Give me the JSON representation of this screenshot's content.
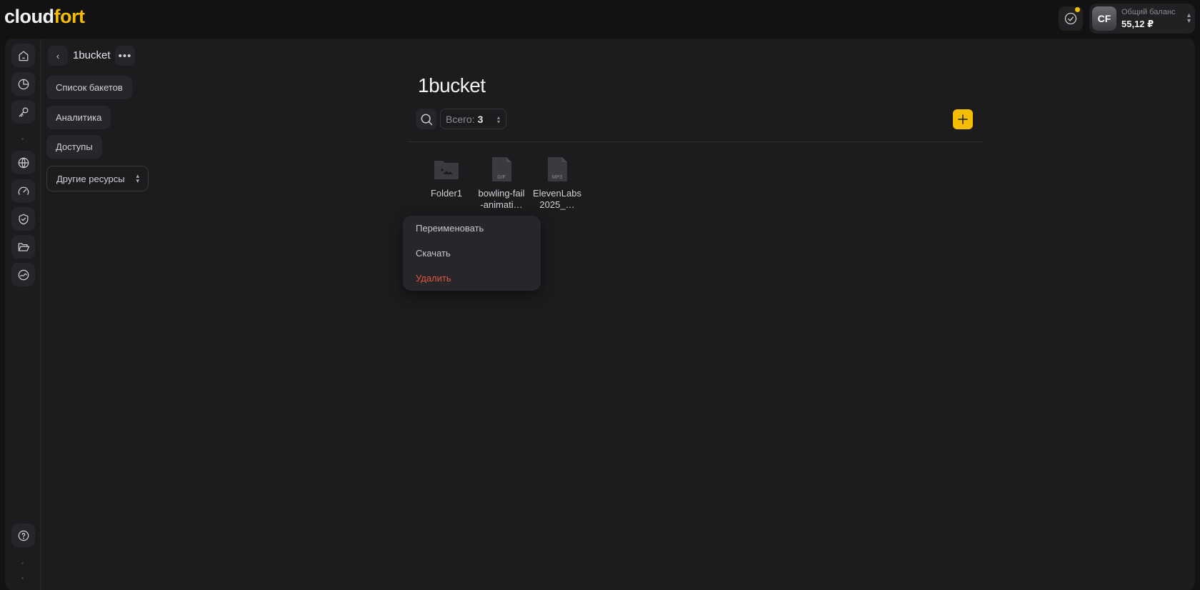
{
  "header": {
    "logo_part1": "cloud",
    "logo_part2": "fort",
    "avatar_initials": "CF",
    "balance_label": "Общий баланс",
    "balance_value": "55,12 ₽"
  },
  "rail": {
    "items": [
      "home-icon",
      "analytics-icon",
      "key-icon",
      "globe-icon",
      "speedometer-icon",
      "shield-check-icon",
      "folder-open-icon",
      "storage-icon"
    ],
    "help_icon": "help-icon"
  },
  "nav": {
    "bucket_name": "1bucket",
    "more_label": "•••",
    "items": [
      "Список бакетов",
      "Аналитика",
      "Доступы"
    ],
    "other_resources": "Другие ресурсы"
  },
  "content": {
    "title": "1bucket",
    "count_label": "Всего:",
    "count_value": "3",
    "files": [
      {
        "name": "Folder1",
        "type": "folder",
        "tag": ""
      },
      {
        "name": "bowling-fail-animati…",
        "type": "file",
        "tag": "GIF"
      },
      {
        "name": "ElevenLabs 2025_…",
        "type": "file",
        "tag": "MP3"
      }
    ]
  },
  "context_menu": {
    "rename": "Переименовать",
    "download": "Скачать",
    "delete": "Удалить"
  },
  "colors": {
    "accent": "#f5bd00",
    "danger": "#e2553f",
    "background": "#1c1c1f"
  }
}
